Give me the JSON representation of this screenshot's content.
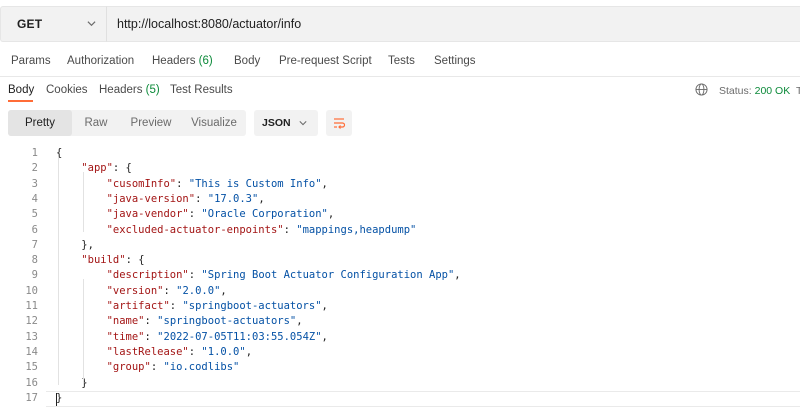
{
  "request": {
    "method": "GET",
    "url": "http://localhost:8080/actuator/info"
  },
  "request_tabs": [
    {
      "label": "Params",
      "count": ""
    },
    {
      "label": "Authorization",
      "count": ""
    },
    {
      "label": "Headers",
      "count": "(6)"
    },
    {
      "label": "Body",
      "count": ""
    },
    {
      "label": "Pre-request Script",
      "count": ""
    },
    {
      "label": "Tests",
      "count": ""
    },
    {
      "label": "Settings",
      "count": ""
    }
  ],
  "response_tabs": [
    {
      "label": "Body",
      "count": ""
    },
    {
      "label": "Cookies",
      "count": ""
    },
    {
      "label": "Headers",
      "count": "(5)"
    },
    {
      "label": "Test Results",
      "count": ""
    }
  ],
  "status": {
    "label": "Status:",
    "value": "200 OK",
    "trail": "T"
  },
  "view_modes": [
    "Pretty",
    "Raw",
    "Preview",
    "Visualize"
  ],
  "format": "JSON",
  "icons": {
    "method_dropdown": "chevron-down-icon",
    "format_dropdown": "chevron-down-icon",
    "network": "globe-icon",
    "wrap": "wrap-lines-icon"
  },
  "colors": {
    "accent": "#ff6c37",
    "success": "#0c8a3a",
    "json_key": "#a31515",
    "json_string": "#0451a5"
  },
  "code_lines": [
    {
      "num": "1",
      "text": "{"
    },
    {
      "num": "2",
      "text": "    \"app\": {"
    },
    {
      "num": "3",
      "text": "        \"cusomInfo\": \"This is Custom Info\","
    },
    {
      "num": "4",
      "text": "        \"java-version\": \"17.0.3\","
    },
    {
      "num": "5",
      "text": "        \"java-vendor\": \"Oracle Corporation\","
    },
    {
      "num": "6",
      "text": "        \"excluded-actuator-enpoints\": \"mappings,heapdump\""
    },
    {
      "num": "7",
      "text": "    },"
    },
    {
      "num": "8",
      "text": "    \"build\": {"
    },
    {
      "num": "9",
      "text": "        \"description\": \"Spring Boot Actuator Configuration App\","
    },
    {
      "num": "10",
      "text": "        \"version\": \"2.0.0\","
    },
    {
      "num": "11",
      "text": "        \"artifact\": \"springboot-actuators\","
    },
    {
      "num": "12",
      "text": "        \"name\": \"springboot-actuators\","
    },
    {
      "num": "13",
      "text": "        \"time\": \"2022-07-05T11:03:55.054Z\","
    },
    {
      "num": "14",
      "text": "        \"lastRelease\": \"1.0.0\","
    },
    {
      "num": "15",
      "text": "        \"group\": \"io.codlibs\""
    },
    {
      "num": "16",
      "text": "    }"
    },
    {
      "num": "17",
      "text": "}"
    }
  ]
}
